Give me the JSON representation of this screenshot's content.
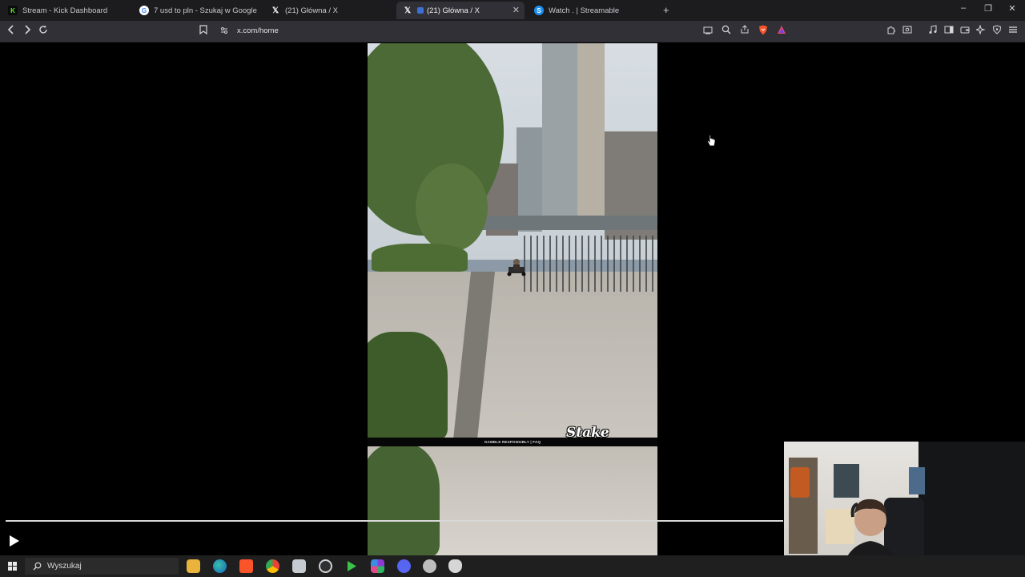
{
  "browser": {
    "tabs": [
      {
        "title": "Stream - Kick Dashboard",
        "icon": "kick-icon",
        "active": false
      },
      {
        "title": "7 usd to pln - Szukaj w Google",
        "icon": "google-icon",
        "active": false
      },
      {
        "title": "(21) Główna / X",
        "icon": "x-icon",
        "active": false
      },
      {
        "title": "(21) Główna / X",
        "icon": "x-icon",
        "active": true
      },
      {
        "title": "Watch . | Streamable",
        "icon": "streamable-icon",
        "active": false
      }
    ],
    "new_tab": "+",
    "window_controls": {
      "minimize": "–",
      "restore": "❐",
      "close": "✕"
    },
    "address": "x.com/home"
  },
  "video": {
    "band_text": "GAMBLE RESPONSIBLY  |  FAQ",
    "logo_text": "Stake",
    "progress": 1.0
  },
  "taskbar": {
    "search_placeholder": "Wyszukaj"
  },
  "colors": {
    "kick": "#53fc18",
    "brave": "#fb542b",
    "chrome_bg": "#1c1c1f",
    "toolbar_bg": "#303036",
    "taskbar_bg": "#1f1f1f"
  }
}
